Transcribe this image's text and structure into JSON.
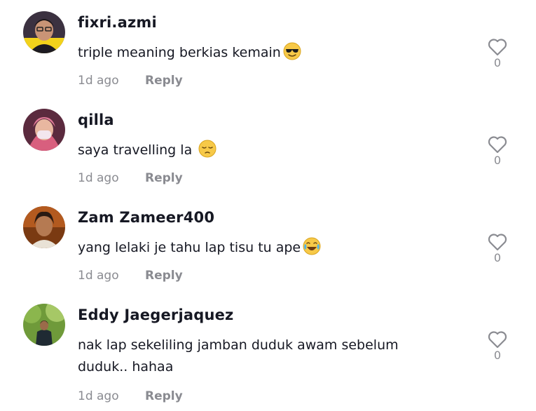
{
  "comments": [
    {
      "username": "fixri.azmi",
      "text": "triple meaning berkias kemain",
      "emoji": "sunglasses-emoji",
      "time": "1d ago",
      "reply_label": "Reply",
      "likes": "0"
    },
    {
      "username": "qilla",
      "text": "saya travelling la ",
      "emoji": "pensive-face-emoji",
      "time": "1d ago",
      "reply_label": "Reply",
      "likes": "0"
    },
    {
      "username": "Zam Zameer400",
      "text": "yang lelaki je tahu lap tisu tu ape",
      "emoji": "tears-of-joy-emoji",
      "time": "1d ago",
      "reply_label": "Reply",
      "likes": "0"
    },
    {
      "username": "Eddy Jaegerjaquez",
      "text_line1": "nak lap sekeliling jamban duduk awam sebelum",
      "text_line2": "duduk.. hahaa",
      "time": "1d ago",
      "reply_label": "Reply",
      "likes": "0"
    }
  ],
  "icons": {
    "like": "heart-outline-icon"
  },
  "colors": {
    "primary_text": "#161823",
    "secondary_text": "#8a8b91"
  }
}
